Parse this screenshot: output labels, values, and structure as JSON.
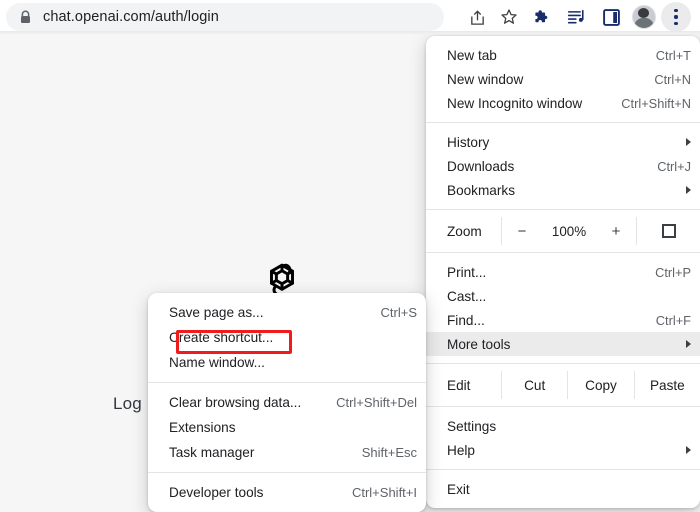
{
  "browser": {
    "url_secure_prefix": "chat.openai.com",
    "url_path": "/auth/login",
    "url_full": "chat.openai.com/auth/login",
    "icons": {
      "lock": "lock-icon",
      "share": "share-icon",
      "star": "star-icon",
      "extensions": "puzzle-piece-icon",
      "reading_list": "reading-list-icon",
      "side_panel": "side-panel-icon",
      "avatar": "avatar",
      "menu": "three-dot-menu-icon"
    }
  },
  "page": {
    "logo": "openai-logo",
    "heading": "Log",
    "background_color": "#f6f6f7"
  },
  "chrome_menu": {
    "items": [
      {
        "label": "New tab",
        "accel": "Ctrl+T"
      },
      {
        "label": "New window",
        "accel": "Ctrl+N"
      },
      {
        "label": "New Incognito window",
        "accel": "Ctrl+Shift+N"
      },
      {
        "label": "History",
        "accel": "",
        "submenu": true
      },
      {
        "label": "Downloads",
        "accel": "Ctrl+J"
      },
      {
        "label": "Bookmarks",
        "accel": "",
        "submenu": true
      },
      {
        "label": "Print...",
        "accel": "Ctrl+P"
      },
      {
        "label": "Cast...",
        "accel": ""
      },
      {
        "label": "Find...",
        "accel": "Ctrl+F"
      },
      {
        "label": "More tools",
        "accel": "",
        "submenu": true,
        "highlighted": true
      },
      {
        "label": "Settings",
        "accel": ""
      },
      {
        "label": "Help",
        "accel": "",
        "submenu": true
      },
      {
        "label": "Exit",
        "accel": ""
      }
    ],
    "zoom_row": {
      "label": "Zoom",
      "minus": "−",
      "value": "100%",
      "plus": "+",
      "fullscreen_icon": "fullscreen-icon"
    },
    "edit_row": {
      "label": "Edit",
      "cut": "Cut",
      "copy": "Copy",
      "paste": "Paste"
    }
  },
  "more_tools_menu": {
    "items": [
      {
        "label": "Save page as...",
        "accel": "Ctrl+S"
      },
      {
        "label": "Create shortcut...",
        "accel": "",
        "highlighted_red": true
      },
      {
        "label": "Name window...",
        "accel": ""
      },
      {
        "label": "Clear browsing data...",
        "accel": "Ctrl+Shift+Del"
      },
      {
        "label": "Extensions",
        "accel": ""
      },
      {
        "label": "Task manager",
        "accel": "Shift+Esc"
      },
      {
        "label": "Developer tools",
        "accel": "Ctrl+Shift+I"
      }
    ],
    "highlight_color": "#ee1c1c"
  }
}
